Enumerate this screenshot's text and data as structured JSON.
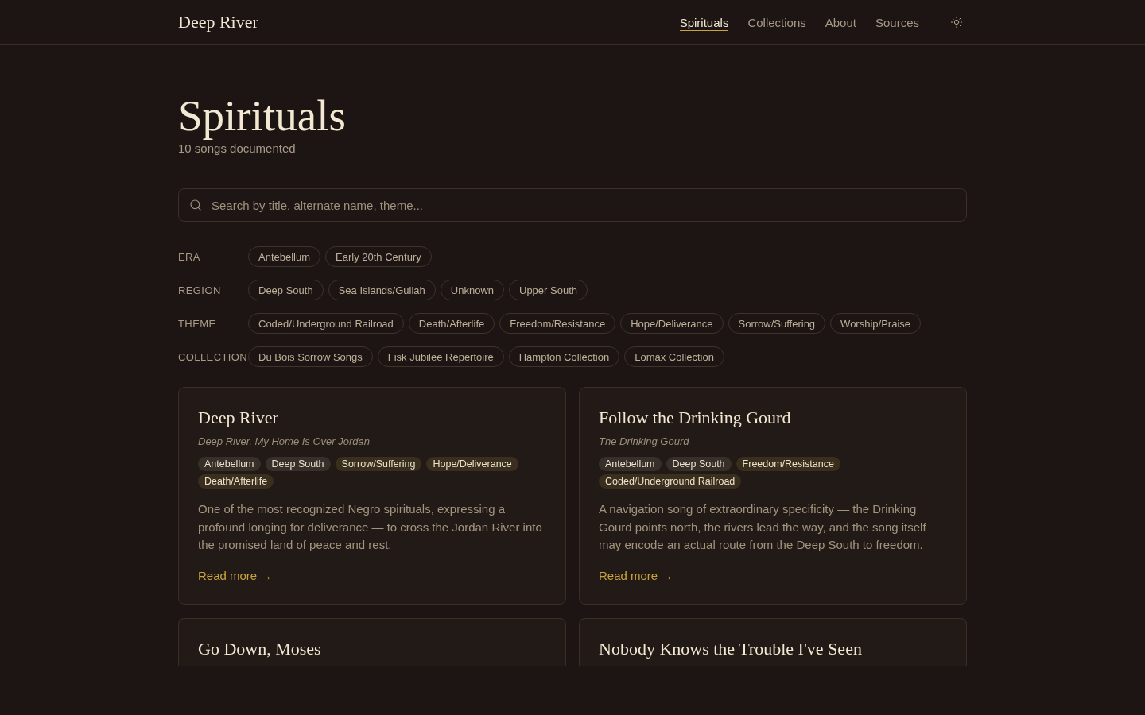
{
  "site": {
    "logo": "Deep River"
  },
  "nav": [
    {
      "label": "Spirituals",
      "selected": true
    },
    {
      "label": "Collections",
      "selected": false
    },
    {
      "label": "About",
      "selected": false
    },
    {
      "label": "Sources",
      "selected": false
    }
  ],
  "page": {
    "title": "Spirituals",
    "subtitle": "10 songs documented"
  },
  "search": {
    "placeholder": "Search by title, alternate name, theme..."
  },
  "filters": [
    {
      "label": "ERA",
      "options": [
        {
          "label": "Antebellum",
          "selected": false
        },
        {
          "label": "Early 20th Century",
          "selected": false
        }
      ]
    },
    {
      "label": "REGION",
      "options": [
        {
          "label": "Deep South",
          "selected": false
        },
        {
          "label": "Sea Islands/Gullah",
          "selected": false
        },
        {
          "label": "Unknown",
          "selected": false
        },
        {
          "label": "Upper South",
          "selected": false
        }
      ]
    },
    {
      "label": "THEME",
      "options": [
        {
          "label": "Coded/Underground Railroad",
          "selected": false
        },
        {
          "label": "Death/Afterlife",
          "selected": false
        },
        {
          "label": "Freedom/Resistance",
          "selected": false
        },
        {
          "label": "Hope/Deliverance",
          "selected": false
        },
        {
          "label": "Sorrow/Suffering",
          "selected": false
        },
        {
          "label": "Worship/Praise",
          "selected": false
        }
      ]
    },
    {
      "label": "COLLECTION",
      "options": [
        {
          "label": "Du Bois Sorrow Songs",
          "selected": false
        },
        {
          "label": "Fisk Jubilee Repertoire",
          "selected": false
        },
        {
          "label": "Hampton Collection",
          "selected": false
        },
        {
          "label": "Lomax Collection",
          "selected": false
        }
      ]
    }
  ],
  "songs": [
    {
      "title": "Deep River",
      "alt_title": "Deep River, My Home Is Over Jordan",
      "tags": [
        {
          "label": "Antebellum",
          "kind": "era"
        },
        {
          "label": "Deep South",
          "kind": "region"
        },
        {
          "label": "Sorrow/Suffering",
          "kind": "theme"
        },
        {
          "label": "Hope/Deliverance",
          "kind": "theme"
        },
        {
          "label": "Death/Afterlife",
          "kind": "theme"
        }
      ],
      "description": "One of the most recognized Negro spirituals, expressing a profound longing for deliverance — to cross the Jordan River into the promised land of peace and rest.",
      "link": "Read more →"
    },
    {
      "title": "Follow the Drinking Gourd",
      "alt_title": "The Drinking Gourd",
      "tags": [
        {
          "label": "Antebellum",
          "kind": "era"
        },
        {
          "label": "Deep South",
          "kind": "region"
        },
        {
          "label": "Freedom/Resistance",
          "kind": "theme"
        },
        {
          "label": "Coded/Underground Railroad",
          "kind": "theme"
        }
      ],
      "description": "A navigation song of extraordinary specificity — the Drinking Gourd points north, the rivers lead the way, and the song itself may encode an actual route from the Deep South to freedom.",
      "link": "Read more →"
    },
    {
      "title": "Go Down, Moses"
    },
    {
      "title": "Nobody Knows the Trouble I've Seen"
    }
  ]
}
